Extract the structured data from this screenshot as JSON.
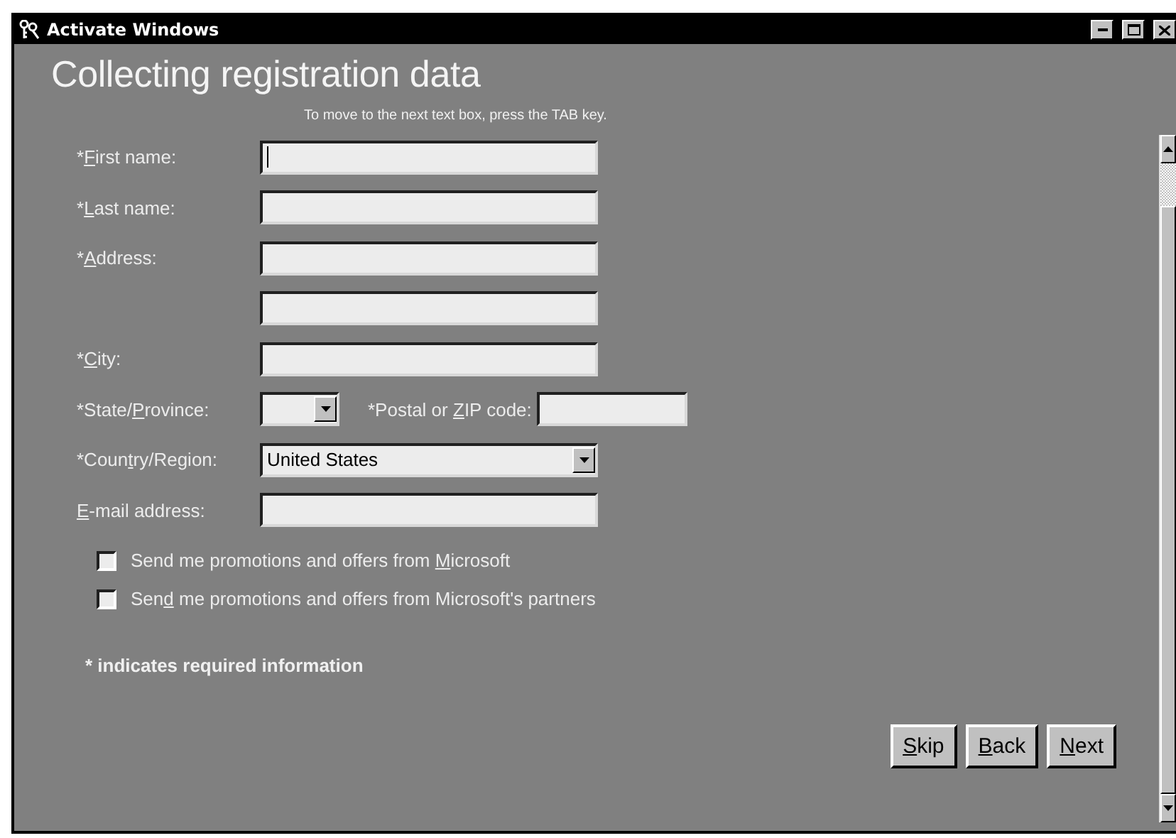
{
  "window": {
    "title": "Activate Windows"
  },
  "heading": "Collecting registration data",
  "instruction": "To move to the next text box, press the TAB key.",
  "fields": [
    {
      "kind": "text",
      "label": {
        "pre": "*",
        "key": "F",
        "post": "irst name:"
      },
      "focused": true
    },
    {
      "kind": "text",
      "label": {
        "pre": "*",
        "key": "L",
        "post": "ast name:"
      },
      "focused": false
    },
    {
      "kind": "text",
      "label": {
        "pre": "*",
        "key": "A",
        "post": "ddress:"
      },
      "focused": false
    },
    {
      "kind": "text",
      "focused": false
    },
    {
      "kind": "text",
      "label": {
        "pre": "*",
        "key": "C",
        "post": "ity:"
      },
      "focused": false
    },
    {
      "kind": "state",
      "label": {
        "pre": "*State/",
        "key": "P",
        "post": "rovince:"
      },
      "postal_label": {
        "pre": "*Postal or ",
        "key": "Z",
        "post": "IP code:"
      }
    },
    {
      "kind": "select",
      "label": {
        "pre": "*Coun",
        "key": "t",
        "post": "ry/Region:"
      },
      "value": "United States"
    },
    {
      "kind": "text",
      "label": {
        "key": "E",
        "post": "-mail address:"
      },
      "focused": false
    }
  ],
  "checkboxes": [
    {
      "label": {
        "pre": "Send me promotions and offers from ",
        "key": "M",
        "post": "icrosoft"
      },
      "checked": false
    },
    {
      "label": {
        "pre": "Sen",
        "key": "d",
        "post": " me promotions and offers from Microsoft's partners"
      },
      "checked": false
    }
  ],
  "footnote": "* indicates required information",
  "buttons": [
    {
      "key": "S",
      "post": "kip"
    },
    {
      "key": "B",
      "post": "ack"
    },
    {
      "key": "N",
      "post": "ext"
    }
  ]
}
